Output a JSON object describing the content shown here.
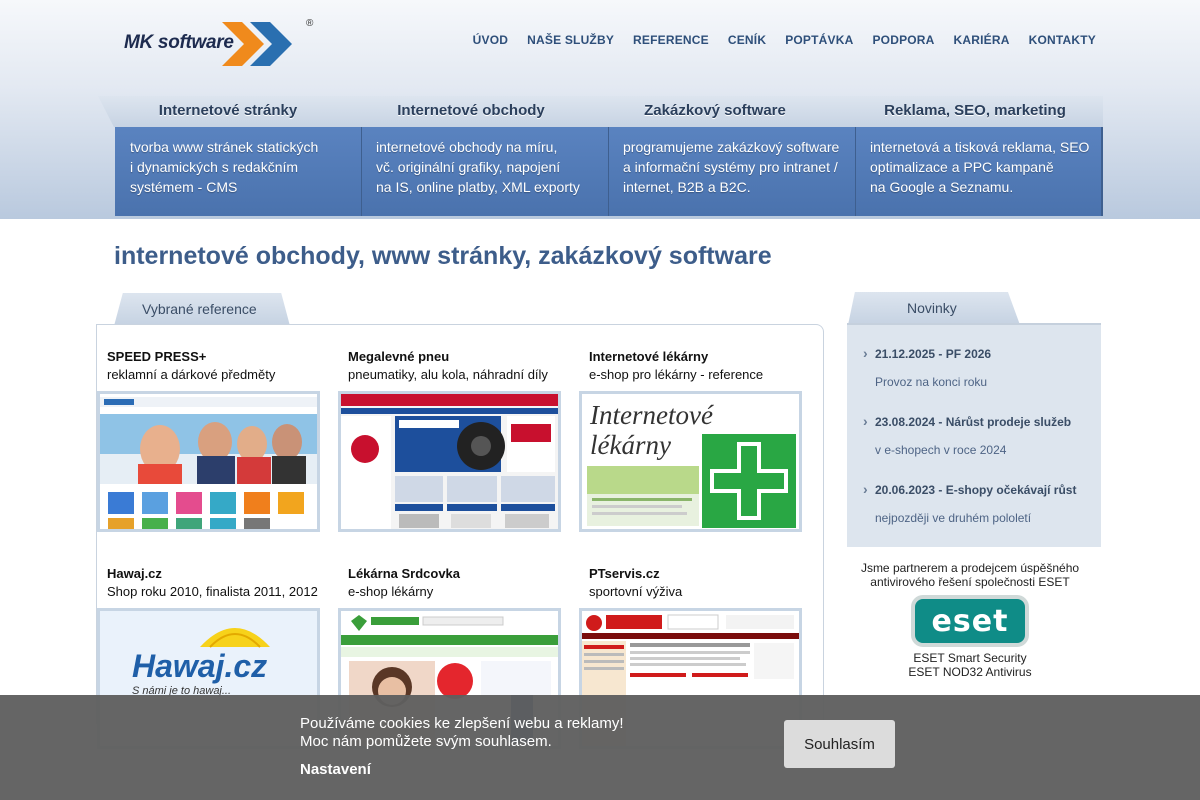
{
  "logo": {
    "text": "MK software",
    "reg": "®"
  },
  "nav": [
    "ÚVOD",
    "NAŠE SLUŽBY",
    "REFERENCE",
    "CENÍK",
    "POPTÁVKA",
    "PODPORA",
    "KARIÉRA",
    "KONTAKTY"
  ],
  "services": [
    {
      "title": "Internetové stránky",
      "desc": [
        "tvorba www stránek statických",
        "i dynamických s redakčním",
        "systémem - CMS"
      ]
    },
    {
      "title": "Internetové obchody",
      "desc": [
        "internetové obchody na míru,",
        "vč. originální grafiky, napojení",
        "na IS, online platby, XML exporty"
      ]
    },
    {
      "title": "Zakázkový software",
      "desc": [
        "programujeme zakázkový software",
        "a informační systémy pro intranet /",
        "internet, B2B a B2C."
      ]
    },
    {
      "title": "Reklama, SEO, marketing",
      "desc": [
        "internetová a tisková reklama, SEO",
        "optimalizace a PPC kampaně",
        "na Google a Seznamu."
      ]
    }
  ],
  "main_title": "internetové obchody, www stránky, zakázkový software",
  "references": {
    "tab": "Vybrané reference",
    "items": [
      {
        "name": "SPEED PRESS+",
        "sub": "reklamní a dárkové předměty",
        "thumb": "speedpress"
      },
      {
        "name": "Megalevné pneu",
        "sub": "pneumatiky, alu kola, náhradní díly",
        "thumb": "pneu"
      },
      {
        "name": "Internetové lékárny",
        "sub": "e-shop pro lékárny - reference",
        "thumb": "lekarny",
        "thumb_text": [
          "Internetové",
          "lékárny"
        ]
      },
      {
        "name": "Hawaj.cz",
        "sub": "Shop roku 2010, finalista 2011, 2012",
        "thumb": "hawaj",
        "thumb_text": [
          "Hawaj.cz",
          "S námi je to hawaj..."
        ]
      },
      {
        "name": "Lékárna Srdcovka",
        "sub": "e-shop lékárny",
        "thumb": "srdcovka"
      },
      {
        "name": "PTservis.cz",
        "sub": "sportovní výživa",
        "thumb": "ptservis"
      }
    ]
  },
  "news": {
    "tab": "Novinky",
    "items": [
      {
        "date": "21.12.2025 - PF 2026",
        "text": "Provoz na konci roku"
      },
      {
        "date": "23.08.2024 - Nárůst prodeje služeb",
        "text": "v e-shopech v roce 2024"
      },
      {
        "date": "20.06.2023 - E-shopy očekávají růst",
        "text": "nejpozději ve druhém pololetí"
      }
    ]
  },
  "eset": {
    "lead": [
      "Jsme partnerem a prodejcem úspěšného",
      "antivirového řešení společnosti ESET"
    ],
    "logo": "eset",
    "products": [
      "ESET Smart Security",
      "ESET NOD32 Antivirus"
    ]
  },
  "cookie": {
    "text": [
      "Používáme cookies ke zlepšení webu a reklamy!",
      "Moc nám pomůžete svým souhlasem."
    ],
    "settings": "Nastavení",
    "button": "Souhlasím"
  },
  "colors": {
    "accent": "#3d5d8a",
    "panel": "#5a83c0",
    "logo_orange": "#f08a1c",
    "logo_blue": "#2a6fb0",
    "eset": "#0f8c87"
  }
}
